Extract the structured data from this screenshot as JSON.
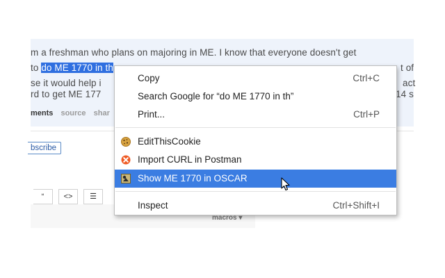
{
  "post": {
    "line1": "m a freshman who plans on majoring in ME. I know that everyone doesn't get",
    "line2_pre": "to ",
    "line2_highlight": "do ME 1770 in th",
    "line2_post": "                                                     ",
    "line2_tail": "t of",
    "line3": "se it would help i",
    "line3_tail": "act",
    "line4": "rd to get ME 177",
    "line4_tail": "14 s"
  },
  "links": {
    "comments": "ments",
    "source": "source",
    "share": "shar"
  },
  "subscribe_label": "bscribe",
  "toolbar": {
    "quote": "“",
    "code": "<>",
    "list": "☰"
  },
  "macros_label": "macros",
  "context_menu": {
    "copy": {
      "label": "Copy",
      "shortcut": "Ctrl+C"
    },
    "search": {
      "label": "Search Google for “do ME 1770 in th”"
    },
    "print": {
      "label": "Print...",
      "shortcut": "Ctrl+P"
    },
    "editthiscookie": {
      "label": "EditThisCookie",
      "icon": "cookie-icon"
    },
    "import_curl": {
      "label": "Import CURL in Postman",
      "icon": "postman-icon"
    },
    "show_oscar": {
      "label": "Show ME 1770 in OSCAR",
      "icon": "oscar-icon"
    },
    "inspect": {
      "label": "Inspect",
      "shortcut": "Ctrl+Shift+I"
    }
  },
  "colors": {
    "selection": "#2f6fe0",
    "menu_highlight": "#3b7de2",
    "link_blue": "#2a5aa5"
  }
}
